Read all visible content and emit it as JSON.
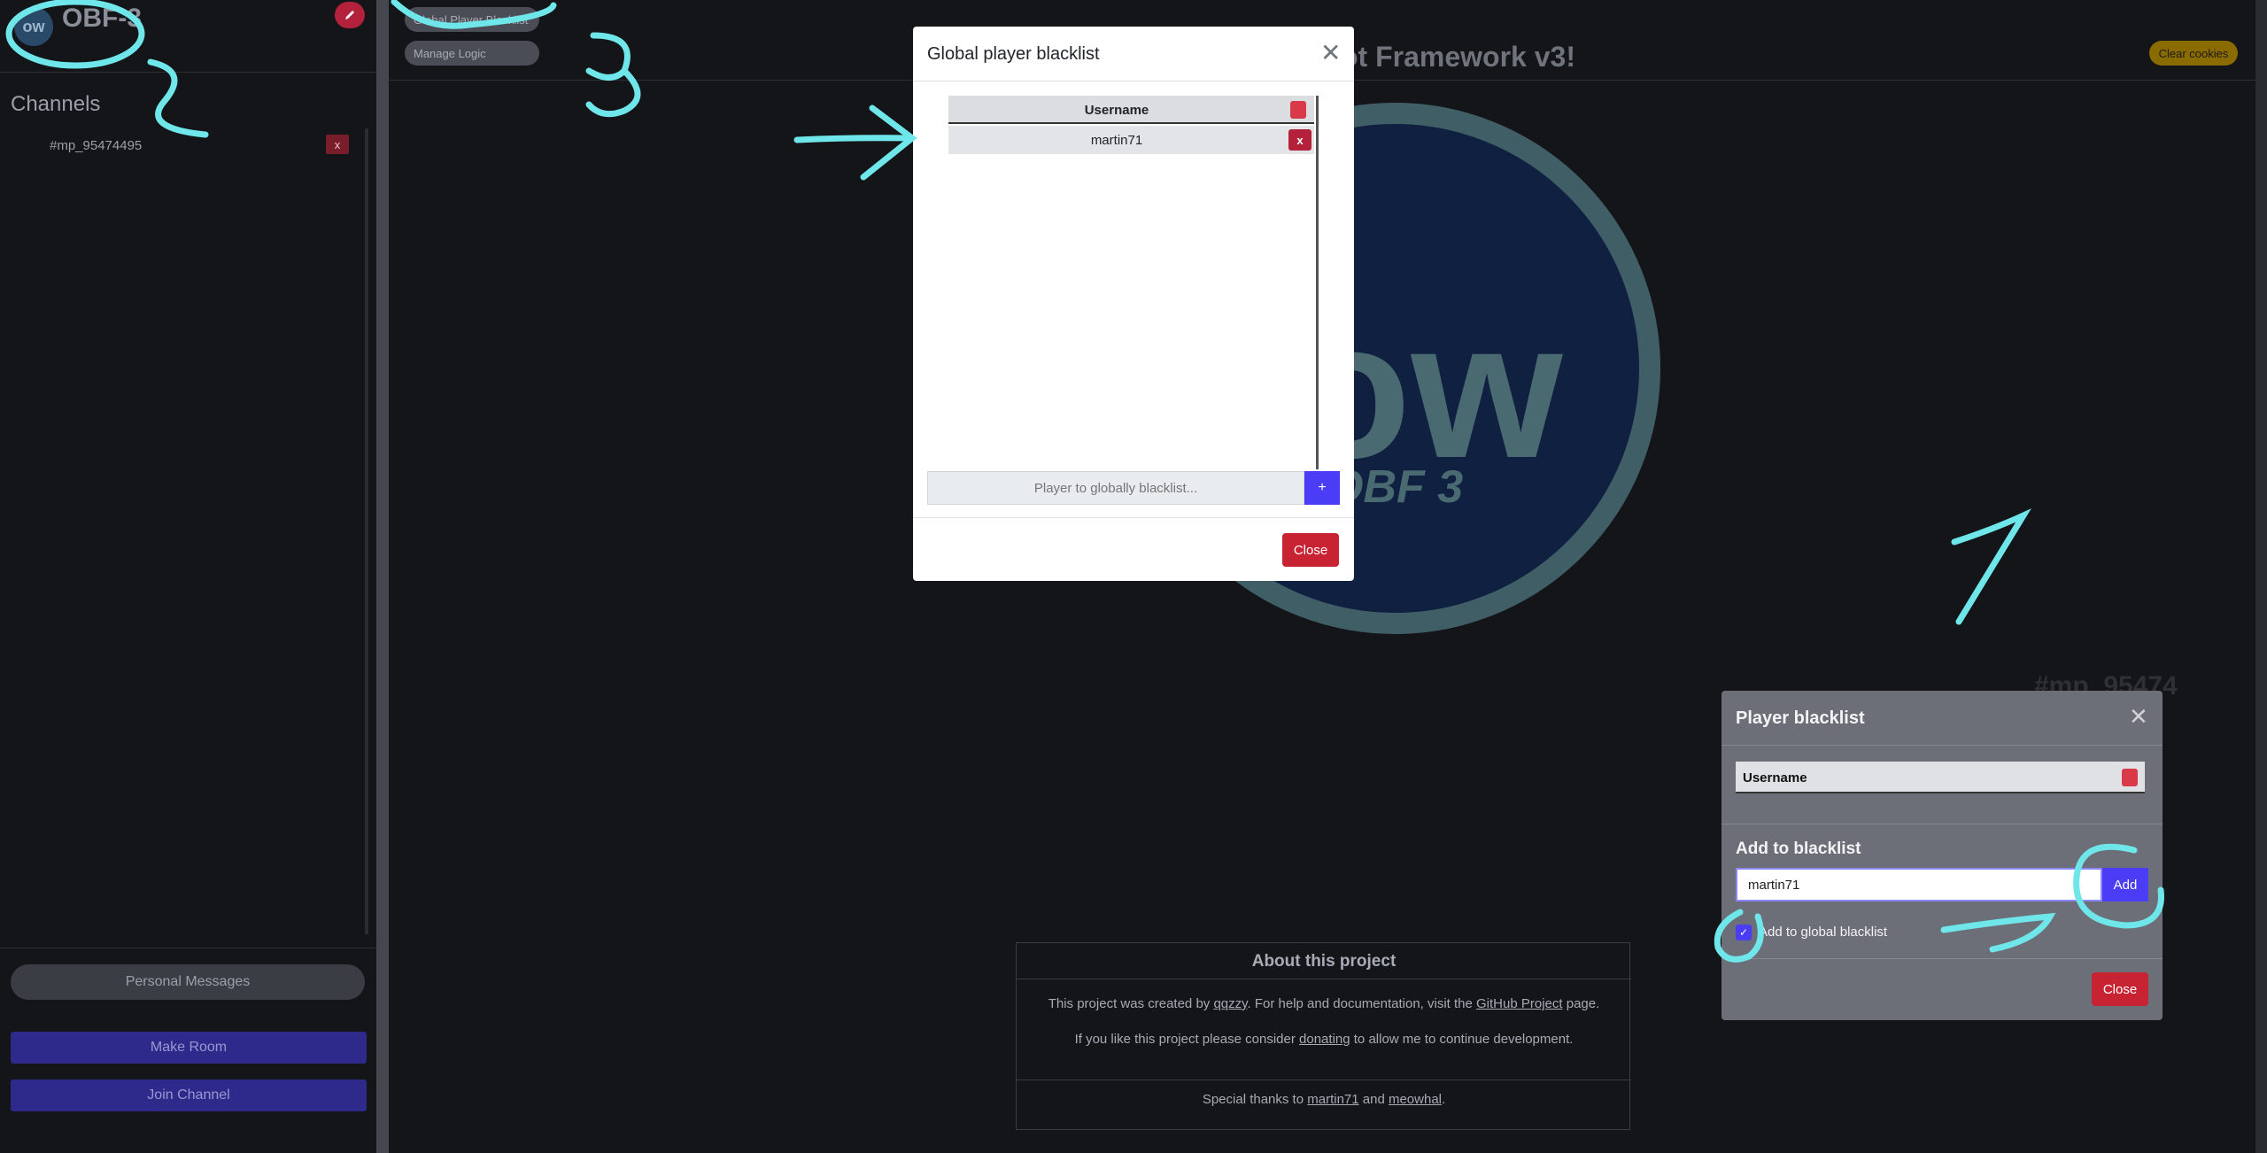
{
  "sidebar": {
    "logo_text": "ow",
    "app_name": "OBF-3",
    "channels_title": "Channels",
    "channels": [
      {
        "name": "#mp_95474495",
        "close_label": "x"
      }
    ],
    "personal_messages": "Personal Messages",
    "make_room": "Make Room",
    "join_channel": "Join Channel"
  },
  "main": {
    "global_blacklist_btn": "Global Player Blacklist",
    "manage_logic_btn": "Manage Logic",
    "title": "ot Framework v3!",
    "clear_cookies": "Clear cookies",
    "logo_ow": "ow",
    "logo_text": "OBF 3",
    "channel_heading": "#mp_95474",
    "about": {
      "title": "About this project",
      "p1_pre": "This project was created by ",
      "p1_author": "qqzzy",
      "p1_mid": ". For help and documentation, visit the ",
      "p1_link": "GitHub Project",
      "p1_post": " page.",
      "p2_pre": "If you like this project please consider ",
      "p2_link": "donating",
      "p2_post": " to allow me to continue development.",
      "p3_pre": "Special thanks to ",
      "p3_a": "martin71",
      "p3_and": " and ",
      "p3_b": "meowhal",
      "p3_post": "."
    }
  },
  "global_modal": {
    "title": "Global player blacklist",
    "column_header": "Username",
    "rows": [
      {
        "username": "martin71",
        "remove_label": "x"
      }
    ],
    "input_placeholder": "Player to globally blacklist...",
    "add_label": "+",
    "close_label": "Close"
  },
  "player_modal": {
    "title": "Player blacklist",
    "column_header": "Username",
    "add_title": "Add to blacklist",
    "input_value": "martin71",
    "add_label": "Add",
    "checkbox_label": "Add to global blacklist",
    "checkbox_checked": true,
    "close_label": "Close"
  },
  "annotations": {
    "numbers": [
      "1",
      "2",
      "3"
    ],
    "color": "#6fe6ea"
  }
}
